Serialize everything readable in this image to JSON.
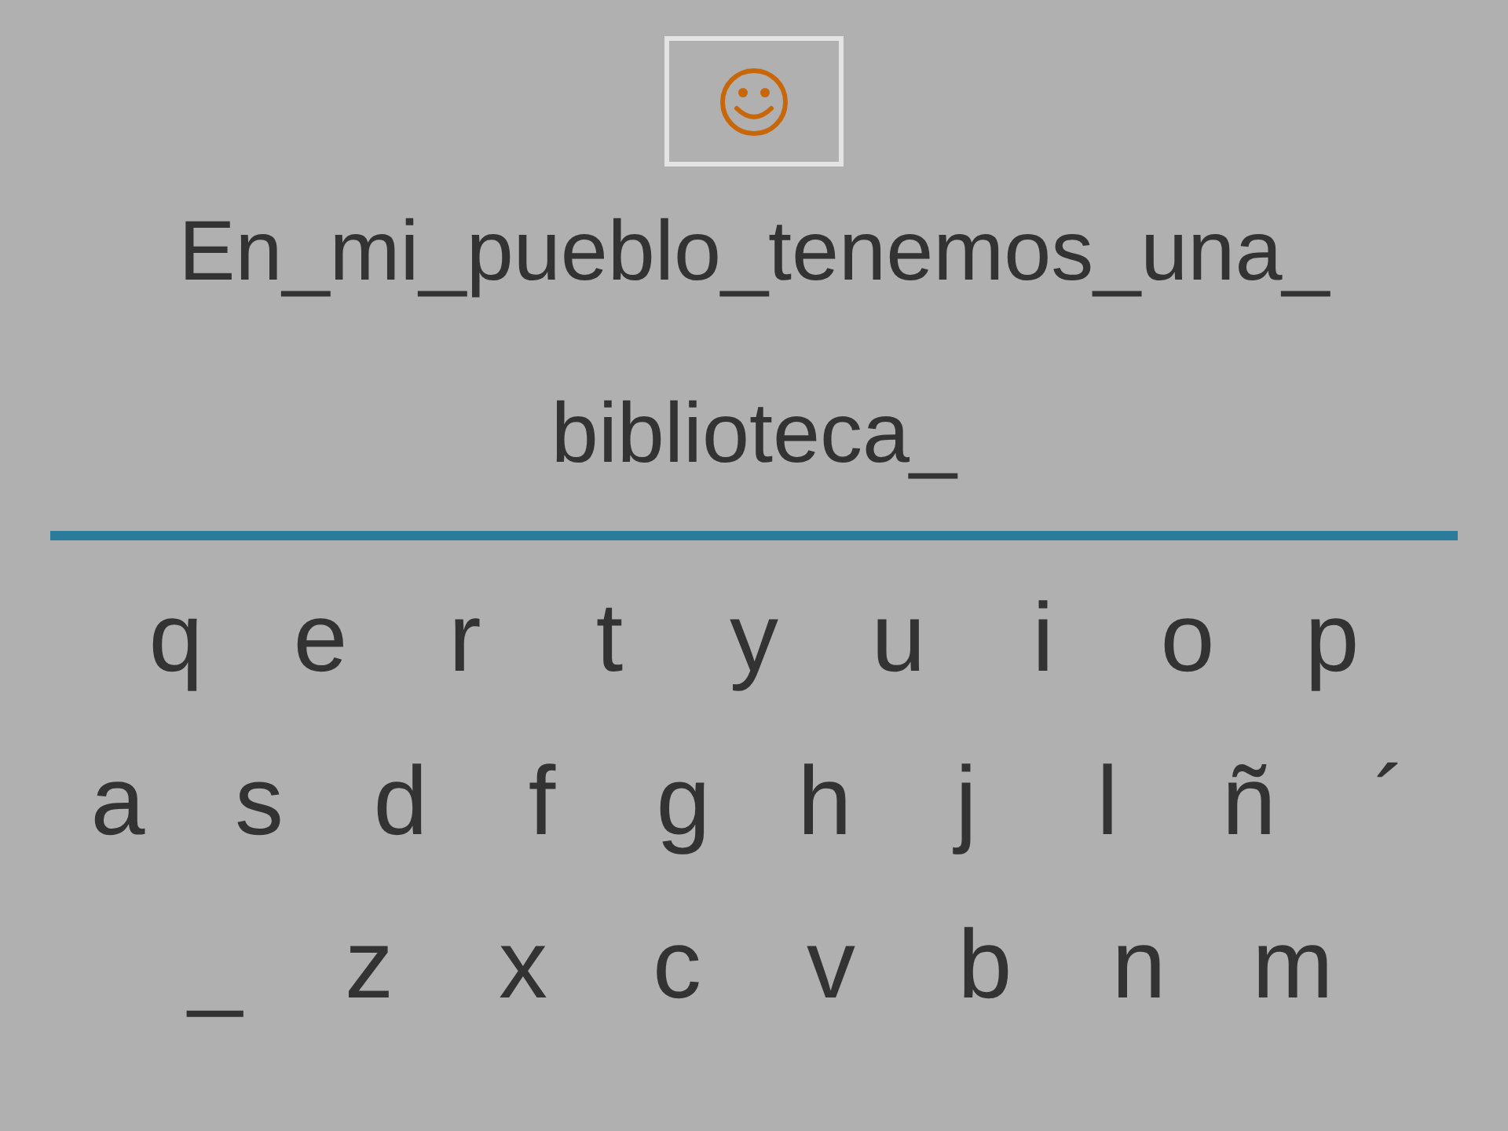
{
  "sentence_lines": [
    "En_mi_pueblo_tenemos_una_",
    "biblioteca_"
  ],
  "keyboard_rows": [
    [
      "q",
      "e",
      "r",
      "t",
      "y",
      "u",
      "i",
      "o",
      "p"
    ],
    [
      "a",
      "s",
      "d",
      "f",
      "g",
      "h",
      "j",
      "l",
      "ñ",
      "´"
    ],
    [
      "_",
      "z",
      "x",
      "c",
      "v",
      "b",
      "n",
      "m"
    ]
  ]
}
